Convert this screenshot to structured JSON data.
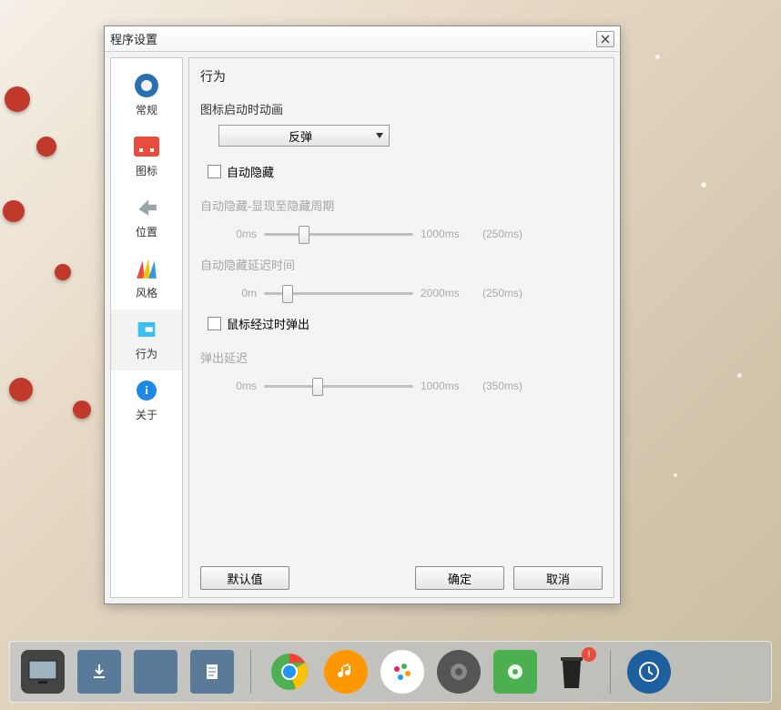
{
  "dialog": {
    "title": "程序设置",
    "sidebar": {
      "items": [
        {
          "label": "常规",
          "icon": "gear-icon"
        },
        {
          "label": "图标",
          "icon": "icon-face"
        },
        {
          "label": "位置",
          "icon": "arrow-icon"
        },
        {
          "label": "风格",
          "icon": "fan-icon"
        },
        {
          "label": "行为",
          "icon": "square-icon"
        },
        {
          "label": "关于",
          "icon": "info-icon"
        }
      ],
      "active_index": 4
    },
    "content": {
      "section_title": "行为",
      "anim_label": "图标启动时动画",
      "anim_dropdown": {
        "selected": "反弹"
      },
      "auto_hide": {
        "label": "自动隐藏",
        "checked": false
      },
      "cycle": {
        "label": "自动隐藏-显现至隐藏周期",
        "min": "0ms",
        "max": "1000ms",
        "value": "(250ms)",
        "pos_pct": 25
      },
      "delay": {
        "label": "自动隐藏延迟时间",
        "min": "0m",
        "max": "2000ms",
        "value": "(250ms)",
        "pos_pct": 13
      },
      "popup": {
        "label": "鼠标经过时弹出",
        "checked": false
      },
      "popup_delay": {
        "label": "弹出延迟",
        "min": "0ms",
        "max": "1000ms",
        "value": "(350ms)",
        "pos_pct": 35
      },
      "buttons": {
        "defaults": "默认值",
        "ok": "确定",
        "cancel": "取消"
      }
    }
  },
  "dock": {
    "items": [
      {
        "name": "monitor-icon"
      },
      {
        "name": "downloads-folder-icon"
      },
      {
        "name": "folder-icon"
      },
      {
        "name": "documents-folder-icon"
      },
      {
        "name": "chrome-icon"
      },
      {
        "name": "music-icon"
      },
      {
        "name": "palette-icon"
      },
      {
        "name": "settings-gear-icon"
      },
      {
        "name": "system-settings-icon"
      },
      {
        "name": "trash-icon",
        "badge": "!"
      },
      {
        "name": "clock-app-icon"
      }
    ]
  }
}
